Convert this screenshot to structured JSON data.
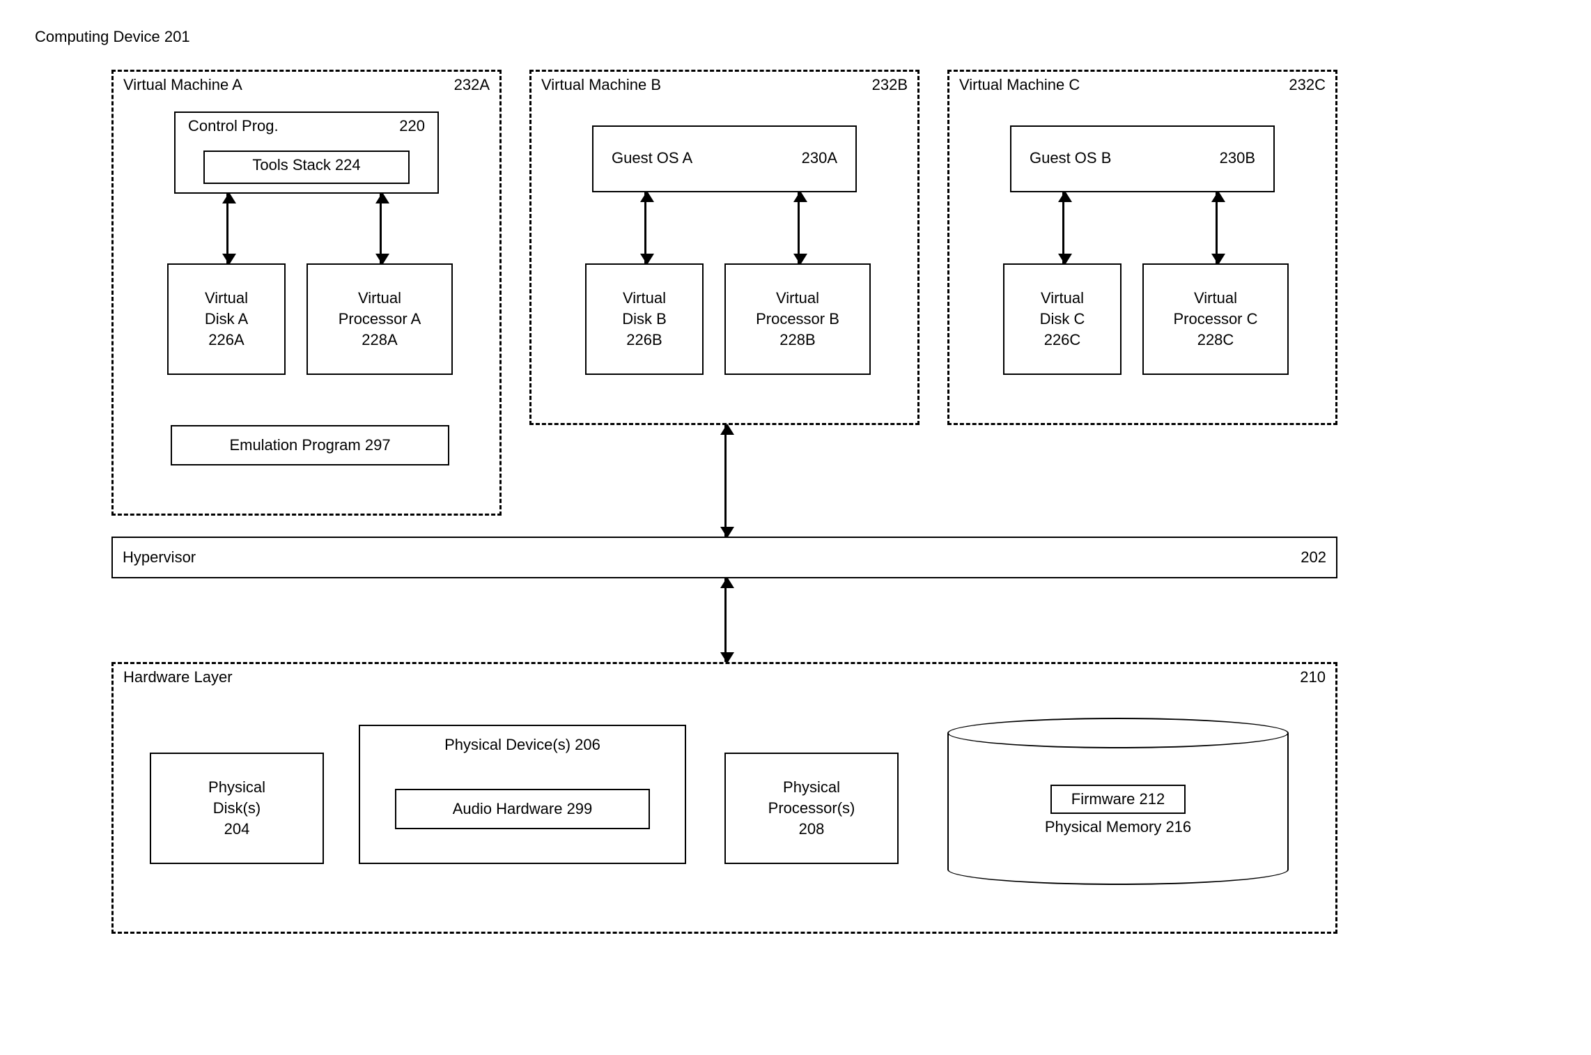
{
  "device_title": "Computing Device 201",
  "vm_a": {
    "name": "Virtual Machine A",
    "ref": "232A",
    "control_prog": "Control Prog.",
    "control_prog_ref": "220",
    "tools_stack": "Tools Stack 224",
    "disk": "Virtual Disk A 226A",
    "proc": "Virtual Processor A 228A",
    "emu": "Emulation Program 297"
  },
  "vm_b": {
    "name": "Virtual Machine B",
    "ref": "232B",
    "guest_os": "Guest OS A",
    "guest_os_ref": "230A",
    "disk": "Virtual Disk B 226B",
    "proc": "Virtual Processor B 228B"
  },
  "vm_c": {
    "name": "Virtual Machine C",
    "ref": "232C",
    "guest_os": "Guest OS B",
    "guest_os_ref": "230B",
    "disk": "Virtual Disk C 226C",
    "proc": "Virtual Processor C 228C"
  },
  "hypervisor": {
    "label": "Hypervisor",
    "ref": "202"
  },
  "hw": {
    "title": "Hardware Layer",
    "ref": "210",
    "phys_disk": "Physical Disk(s) 204",
    "phys_dev": "Physical Device(s) 206",
    "audio": "Audio Hardware 299",
    "phys_proc": "Physical Processor(s) 208",
    "firmware": "Firmware 212",
    "memory": "Physical Memory 216"
  }
}
